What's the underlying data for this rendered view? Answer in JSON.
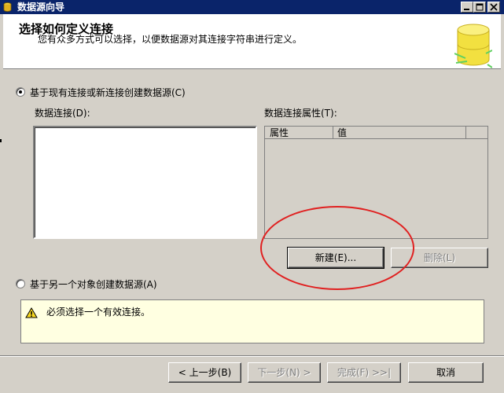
{
  "window": {
    "title": "数据源向导"
  },
  "header": {
    "title": "选择如何定义连接",
    "description": "您有众多方式可以选择，以便数据源对其连接字符串进行定义。"
  },
  "options": {
    "existing_label": "基于现有连接或新连接创建数据源(C)",
    "existing_selected": true,
    "other_label": "基于另一个对象创建数据源(A)"
  },
  "connections": {
    "label": "数据连接(D):",
    "items": []
  },
  "properties": {
    "label": "数据连接属性(T):",
    "columns": [
      "属性",
      "值"
    ]
  },
  "buttons": {
    "new": "新建(E)...",
    "delete": "删除(L)"
  },
  "warning": {
    "text": "必须选择一个有效连接。"
  },
  "footer": {
    "back": "< 上一步(B)",
    "next": "下一步(N) >",
    "finish": "完成(F) >>|",
    "cancel": "取消"
  },
  "colors": {
    "titlebar": "#0a246a",
    "warning_bg": "#ffffe1",
    "highlight": "#e02020"
  },
  "icons": {
    "title": "datasource-icon",
    "header": "database-icon",
    "warning": "warning-icon"
  }
}
